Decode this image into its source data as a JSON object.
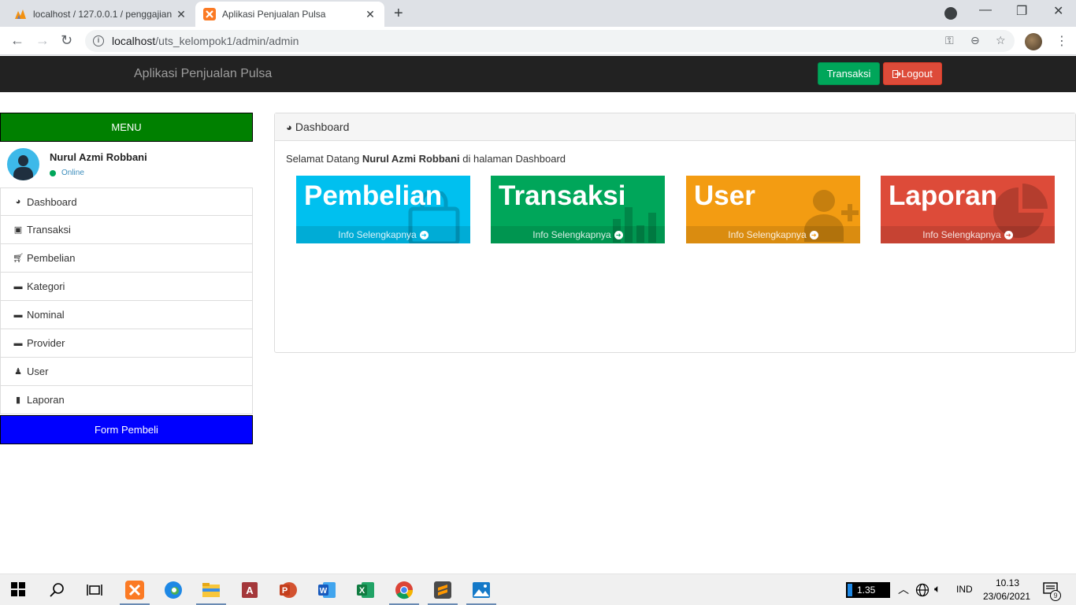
{
  "browser": {
    "tabs": [
      {
        "title": "localhost / 127.0.0.1 / penggajian",
        "active": false
      },
      {
        "title": "Aplikasi Penjualan Pulsa",
        "active": true
      }
    ],
    "url_host": "localhost",
    "url_path": "/uts_kelompok1/admin/admin"
  },
  "navbar": {
    "brand": "Aplikasi Penjualan Pulsa",
    "transaksi_btn": "Transaksi",
    "logout_btn": "Logout",
    "colors": {
      "bg": "#222222",
      "success": "#00a65a",
      "danger": "#dd4b39"
    }
  },
  "sidebar": {
    "menu_header": "MENU",
    "user": {
      "name": "Nurul Azmi Robbani",
      "status": "Online"
    },
    "items": [
      {
        "label": "Dashboard",
        "icon": "dashboard-icon"
      },
      {
        "label": "Transaksi",
        "icon": "money-icon"
      },
      {
        "label": "Pembelian",
        "icon": "cart-icon"
      },
      {
        "label": "Kategori",
        "icon": "folder-icon"
      },
      {
        "label": "Nominal",
        "icon": "folder-icon"
      },
      {
        "label": "Provider",
        "icon": "folder-icon"
      },
      {
        "label": "User",
        "icon": "user-secret-icon"
      },
      {
        "label": "Laporan",
        "icon": "file-icon"
      }
    ],
    "form_button": "Form Pembeli"
  },
  "dashboard": {
    "title": "Dashboard",
    "welcome_prefix": "Selamat Datang",
    "welcome_name": "Nurul Azmi Robbani",
    "welcome_suffix": "di halaman Dashboard",
    "boxes": [
      {
        "title": "Pembelian",
        "link": "Info Selengkapnya",
        "color": "#00c0ef",
        "icon": "shopping-bag-icon"
      },
      {
        "title": "Transaksi",
        "link": "Info Selengkapnya",
        "color": "#00a65a",
        "icon": "bar-chart-icon"
      },
      {
        "title": "User",
        "link": "Info Selengkapnya",
        "color": "#f39c12",
        "icon": "user-plus-icon"
      },
      {
        "title": "Laporan",
        "link": "Info Selengkapnya",
        "color": "#dd4b39",
        "icon": "pie-chart-icon"
      }
    ]
  },
  "taskbar": {
    "battery_value": "1.35",
    "language": "IND",
    "time": "10.13",
    "date": "23/06/2021",
    "notifications": "9"
  }
}
